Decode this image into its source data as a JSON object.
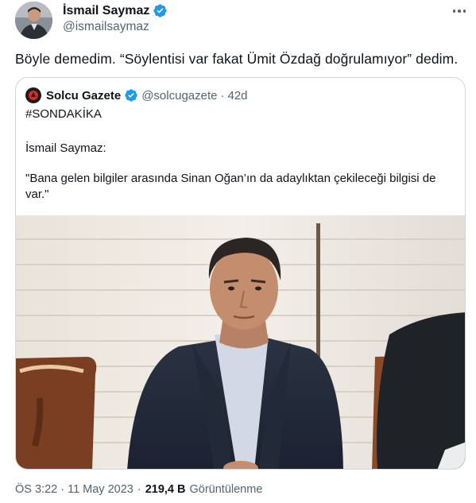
{
  "author": {
    "name": "İsmail Saymaz",
    "handle": "@ismailsaymaz",
    "verified": true,
    "avatar": "man-in-dark-jacket-portrait"
  },
  "tweet": {
    "text": "Böyle demedim. “Söylentisi var fakat Ümit Özdağ doğrulamıyor” dedim."
  },
  "quoted_tweet": {
    "author_name": "Solcu Gazete",
    "author_handle": "@solcugazete",
    "separator": "·",
    "time": "42d",
    "verified": true,
    "lines": [
      "#SONDAKİKA",
      "İsmail Saymaz:",
      "\"Bana gelen bilgiler arasında Sinan Oğan’ın da adaylıktan çekileceği bilgisi de",
      "var.\""
    ],
    "image": "photo-of-man-in-dark-suit-seated"
  },
  "meta": {
    "timestamp": "ÖS 3:22 · 11 May 2023",
    "separator": "·",
    "views_count": "219,4 B",
    "views_label": "Görüntülenme"
  },
  "colors": {
    "verified_blue": "#1d9bf0",
    "secondary_text": "#536471",
    "border": "#cfd9de"
  }
}
